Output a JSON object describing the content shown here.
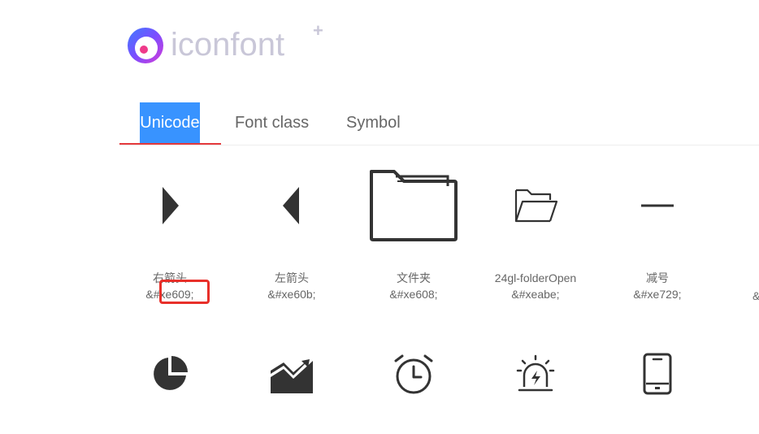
{
  "logo": {
    "text": "iconfont",
    "plus": "+"
  },
  "tabs": [
    {
      "label": "Unicode",
      "active": true
    },
    {
      "label": "Font class",
      "active": false
    },
    {
      "label": "Symbol",
      "active": false
    }
  ],
  "icons_row1": [
    {
      "name": "右箭头",
      "code": "&#xe609;",
      "icon": "triangle-right-icon"
    },
    {
      "name": "左箭头",
      "code": "&#xe60b;",
      "icon": "triangle-left-icon"
    },
    {
      "name": "文件夹",
      "code": "&#xe608;",
      "icon": "folder-icon"
    },
    {
      "name": "24gl-folderOpen",
      "code": "&#xeabe;",
      "icon": "folder-open-icon"
    },
    {
      "name": "减号",
      "code": "&#xe729;",
      "icon": "minus-icon"
    }
  ],
  "icons_row1_cut_code": "&",
  "icons_row2": [
    {
      "icon": "pie-chart-icon"
    },
    {
      "icon": "trend-chart-icon"
    },
    {
      "icon": "alarm-clock-icon"
    },
    {
      "icon": "alarm-light-icon"
    },
    {
      "icon": "mobile-phone-icon"
    }
  ],
  "colors": {
    "active_tab_bg": "#3893ff",
    "active_tab_underline": "#e4393c",
    "highlight": "#e8302a",
    "icon": "#333333",
    "logo_text": "#c9c7d8"
  }
}
